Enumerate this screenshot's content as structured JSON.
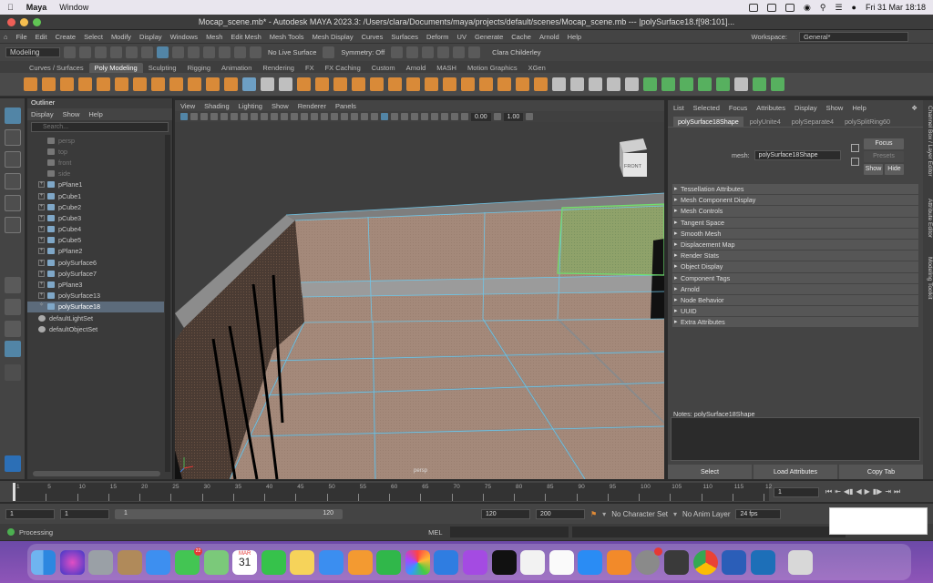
{
  "macos_menu": {
    "app": "Maya",
    "items": [
      "Window"
    ],
    "clock": "Fri 31 Mar  18:18"
  },
  "title": "Mocap_scene.mb* - Autodesk MAYA 2023.3: /Users/clara/Documents/maya/projects/default/scenes/Mocap_scene.mb  ---  |polySurface18.f[98:101]...",
  "maya_menu": [
    "File",
    "Edit",
    "Create",
    "Select",
    "Modify",
    "Display",
    "Windows",
    "Mesh",
    "Edit Mesh",
    "Mesh Tools",
    "Mesh Display",
    "Curves",
    "Surfaces",
    "Deform",
    "UV",
    "Generate",
    "Cache",
    "Arnold",
    "Help"
  ],
  "workspace": {
    "label": "Workspace:",
    "value": "General*"
  },
  "status_line": {
    "mode": "Modeling",
    "live_surface": "No Live Surface",
    "symmetry": "Symmetry: Off",
    "user": "Clara Childerley"
  },
  "shelf_tabs": [
    "Curves / Surfaces",
    "Poly Modeling",
    "Sculpting",
    "Rigging",
    "Animation",
    "Rendering",
    "FX",
    "FX Caching",
    "Custom",
    "Arnold",
    "MASH",
    "Motion Graphics",
    "XGen"
  ],
  "shelf_active": "Poly Modeling",
  "outliner": {
    "title": "Outliner",
    "menu": [
      "Display",
      "Show",
      "Help"
    ],
    "search_placeholder": "Search...",
    "items": [
      {
        "label": "persp",
        "type": "camera"
      },
      {
        "label": "top",
        "type": "camera"
      },
      {
        "label": "front",
        "type": "camera"
      },
      {
        "label": "side",
        "type": "camera"
      },
      {
        "label": "pPlane1",
        "type": "mesh"
      },
      {
        "label": "pCube1",
        "type": "mesh"
      },
      {
        "label": "pCube2",
        "type": "mesh"
      },
      {
        "label": "pCube3",
        "type": "mesh"
      },
      {
        "label": "pCube4",
        "type": "mesh"
      },
      {
        "label": "pCube5",
        "type": "mesh"
      },
      {
        "label": "pPlane2",
        "type": "mesh"
      },
      {
        "label": "polySurface6",
        "type": "mesh"
      },
      {
        "label": "polySurface7",
        "type": "mesh"
      },
      {
        "label": "pPlane3",
        "type": "mesh"
      },
      {
        "label": "polySurface13",
        "type": "mesh"
      },
      {
        "label": "polySurface18",
        "type": "mesh",
        "selected": true
      },
      {
        "label": "defaultLightSet",
        "type": "set"
      },
      {
        "label": "defaultObjectSet",
        "type": "set"
      }
    ]
  },
  "viewport": {
    "menu": [
      "View",
      "Shading",
      "Lighting",
      "Show",
      "Renderer",
      "Panels"
    ],
    "field1": "0.00",
    "field2": "1.00",
    "camera_label": "persp",
    "viewcube": "FRONT"
  },
  "attribute_editor": {
    "menu": [
      "List",
      "Selected",
      "Focus",
      "Attributes",
      "Display",
      "Show",
      "Help"
    ],
    "tabs": [
      "polySurface18Shape",
      "polyUnite4",
      "polySeparate4",
      "polySplitRing60"
    ],
    "mesh_label": "mesh:",
    "mesh_value": "polySurface18Shape",
    "focus": "Focus",
    "presets": "Presets",
    "show": "Show",
    "hide": "Hide",
    "sections": [
      "Tessellation Attributes",
      "Mesh Component Display",
      "Mesh Controls",
      "Tangent Space",
      "Smooth Mesh",
      "Displacement Map",
      "Render Stats",
      "Object Display",
      "Component Tags",
      "Arnold",
      "Node Behavior",
      "UUID",
      "Extra Attributes"
    ],
    "notes": "Notes:  polySurface18Shape",
    "buttons": [
      "Select",
      "Load Attributes",
      "Copy Tab"
    ]
  },
  "side_tabs": [
    "Channel Box / Layer Editor",
    "Attribute Editor",
    "Modeling Toolkit"
  ],
  "time_slider": {
    "ticks": [
      "1",
      "5",
      "10",
      "15",
      "20",
      "25",
      "30",
      "35",
      "40",
      "45",
      "50",
      "55",
      "60",
      "65",
      "70",
      "75",
      "80",
      "85",
      "90",
      "95",
      "100",
      "105",
      "110",
      "115",
      "12"
    ],
    "current_frame": "1"
  },
  "range_slider": {
    "start": "1",
    "start2": "1",
    "range_start": "1",
    "range_end": "120",
    "end": "120",
    "end2": "200",
    "character_set": "No Character Set",
    "anim_layer": "No Anim Layer",
    "fps": "24 fps"
  },
  "command_line": {
    "status": "Processing",
    "mel": "MEL"
  },
  "dock": {
    "apps": [
      "finder",
      "siri",
      "launchpad",
      "notes-app",
      "mail",
      "messages",
      "maps",
      "calendar",
      "facetime",
      "notes",
      "safari",
      "pages",
      "numbers",
      "photos",
      "keynote",
      "podcasts",
      "apple-tv",
      "news",
      "reminders",
      "app-store",
      "books",
      "system-settings",
      "unity",
      "chrome",
      "word",
      "maya",
      "trash"
    ],
    "messages_badge": "22",
    "calendar_month": "MAR",
    "calendar_day": "31"
  }
}
